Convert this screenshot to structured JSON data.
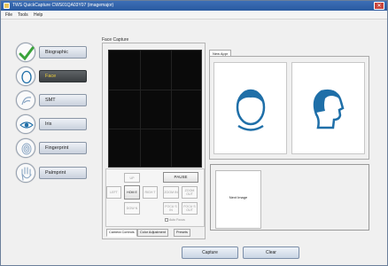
{
  "window": {
    "title": "TWS QuickCapture CWS01QA03Y07 (imagemajor)",
    "close_label": "✕"
  },
  "menu": [
    "File",
    "Tools",
    "Help"
  ],
  "sidebar": {
    "items": [
      {
        "label": "Biographic",
        "icon": "checkmark-icon",
        "active": false
      },
      {
        "label": "Face",
        "icon": "face-icon",
        "active": true
      },
      {
        "label": "SMT",
        "icon": "tattoo-icon",
        "active": false
      },
      {
        "label": "Iris",
        "icon": "eye-icon",
        "active": false
      },
      {
        "label": "Fingerprint",
        "icon": "fingerprint-icon",
        "active": false
      },
      {
        "label": "Palmprint",
        "icon": "palm-icon",
        "active": false
      }
    ]
  },
  "face_capture": {
    "group_title": "Face Capture",
    "pause_label": "PAUSE",
    "camera_buttons": [
      {
        "label": "UP",
        "enabled": false
      },
      {
        "label": "LEFT",
        "enabled": false
      },
      {
        "label": "HOM E",
        "enabled": true
      },
      {
        "label": "RIGH T",
        "enabled": false
      },
      {
        "label": "DOW N",
        "enabled": false
      },
      {
        "label": "ZOOM IN",
        "enabled": false
      },
      {
        "label": "ZOOM OUT",
        "enabled": false
      },
      {
        "label": "FOCU S IN",
        "enabled": false
      },
      {
        "label": "FOCU S OUT",
        "enabled": false
      }
    ],
    "auto_focus_label": "Auto Focus",
    "tabs": [
      {
        "label": "Camera Controls",
        "active": true
      },
      {
        "label": "Color Adjustment",
        "active": false
      },
      {
        "label": "Presets",
        "active": false
      }
    ]
  },
  "right_panel": {
    "tab_label": "New Appr",
    "poses": [
      "frontal-face-icon",
      "profile-face-icon"
    ],
    "thumbnail_text": "Next Image",
    "accent_color": "#1f6fa8"
  },
  "buttons": {
    "capture": "Capture",
    "clear": "Clear"
  }
}
